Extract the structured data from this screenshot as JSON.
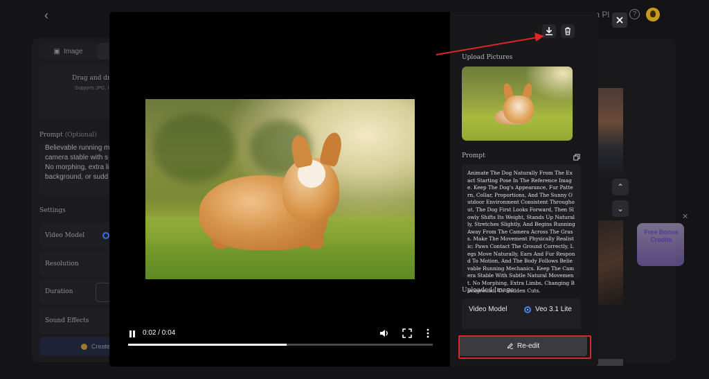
{
  "background": {
    "header": {
      "extra_label": "xtra Pl",
      "help_glyph": "?"
    },
    "left_panel": {
      "tab_image": "Image",
      "drop_title": "Drag and drop",
      "drop_sub": "Supports JPG, I",
      "prompt_label": "Prompt",
      "prompt_optional": "(Optional)",
      "prompt_lines": [
        "Believable running m",
        "camera stable with s",
        "No morphing, extra li",
        "background, or sudd"
      ],
      "settings_label": "Settings",
      "video_model_label": "Video Model",
      "resolution_label": "Resolution",
      "duration_label": "Duration",
      "sound_effects_label": "Sound Effects",
      "create_label": "Create"
    },
    "bonus_card": {
      "text": "Free Bonus Credits"
    }
  },
  "player": {
    "time": "0:02 / 0:04",
    "progress": 0.52
  },
  "side_panel": {
    "upload_label": "Upload Pictures",
    "prompt_label": "Prompt",
    "prompt_text": "Animate The Dog Naturally From The Exact Starting Pose In The Reference Image. Keep The Dog's Appearance, Fur Pattern, Collar, Proportions, And The Sunny Outdoor Environment Consistent Throughout. The Dog First Looks Forward, Then Slowly Shifts Its Weight, Stands Up Naturally, Stretches Slightly, And Begins Running Away From The Camera Across The Grass. Make The Movement Physically Realistic: Paws Contact The Ground Correctly, Legs Move Naturally, Ears And Fur Respond To Motion, And The Body Follows Believable Running Mechanics. Keep The Camera Stable With Subtle Natural Movement. No Morphing, Extra Limbs, Changing Background, Or Sudden Cuts.",
    "uploaded_image_label": "Uploaded Image",
    "video_model_label": "Video Model",
    "video_model_value": "Veo 3.1 Lite",
    "reedit_label": "Re-edit"
  },
  "icons": {
    "download": "download-icon",
    "delete": "trash-icon",
    "close": "close-icon",
    "copy": "copy-icon",
    "edit": "pencil-icon"
  },
  "colors": {
    "annotation_red": "#e02626",
    "accent_blue": "#3b82f6"
  }
}
